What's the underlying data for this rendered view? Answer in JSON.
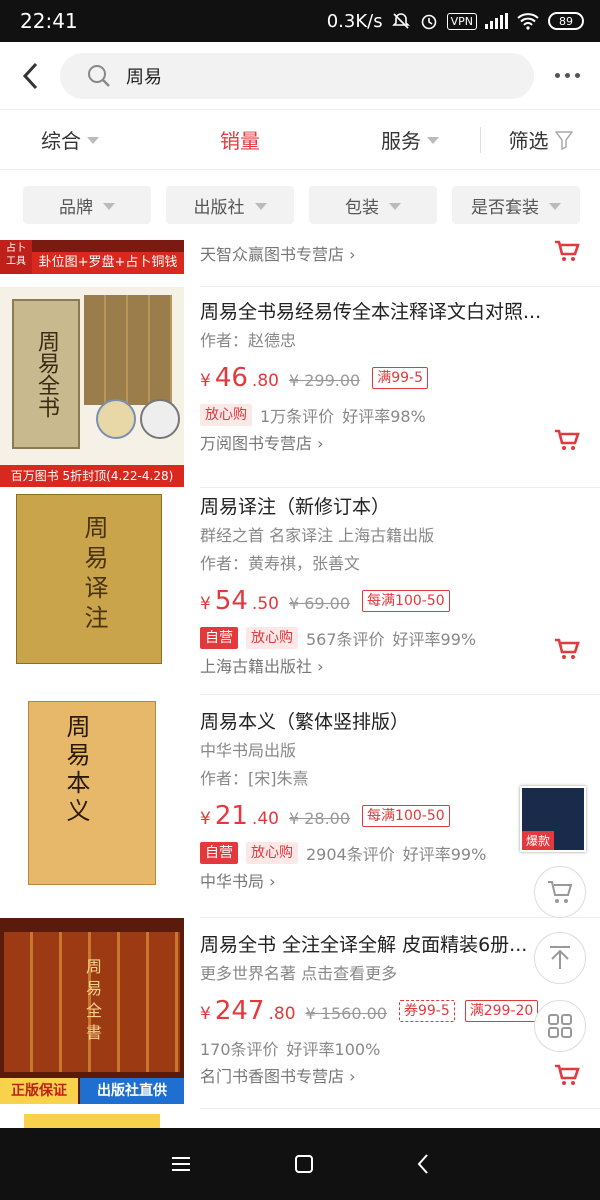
{
  "status": {
    "time": "22:41",
    "speed": "0.3K/s",
    "vpn": "VPN",
    "battery": "89"
  },
  "search": {
    "query": "周易"
  },
  "sort": {
    "items": [
      "综合",
      "销量",
      "服务",
      "筛选"
    ],
    "active_color": "#e4393c"
  },
  "filters": [
    "品牌",
    "出版社",
    "包装",
    "是否套装"
  ],
  "partial_item": {
    "banner": "卦位图+罗盘+占卜铜钱",
    "badge": "占卜\n工具",
    "shop": "天智众赢图书专营店"
  },
  "items": [
    {
      "title": "周易全书易经易传全本注释译文白对照...",
      "subtitle": "",
      "author": "作者：赵德忠",
      "price_int": "46",
      "price_dec": ".80",
      "orig": "¥ 299.00",
      "promo": "满99-5",
      "tags": [
        "放心购"
      ],
      "reviews": "1万条评价",
      "rate": "好评率98%",
      "shop": "万阅图书专营店",
      "banner": "百万图书 5折封顶(4.22-4.28)"
    },
    {
      "title": "周易译注（新修订本）",
      "subtitle": "群经之首 名家译注 上海古籍出版",
      "author": "作者：黄寿祺，张善文",
      "price_int": "54",
      "price_dec": ".50",
      "orig": "¥ 69.00",
      "promo": "每满100-50",
      "tags": [
        "自营",
        "放心购"
      ],
      "reviews": "567条评价",
      "rate": "好评率99%",
      "shop": "上海古籍出版社"
    },
    {
      "title": "周易本义（繁体竖排版）",
      "subtitle": "中华书局出版",
      "author": "作者：[宋]朱熹",
      "price_int": "21",
      "price_dec": ".40",
      "orig": "¥ 28.00",
      "promo": "每满100-50",
      "tags": [
        "自营",
        "放心购"
      ],
      "reviews": "2904条评价",
      "rate": "好评率99%",
      "shop": "中华书局"
    },
    {
      "title": "周易全书 全注全译全解 皮面精装6册...",
      "subtitle": "更多世界名著 点击查看更多",
      "author": "",
      "price_int": "247",
      "price_dec": ".80",
      "orig": "¥ 1560.00",
      "coupon": "券99-5",
      "promo": "满299-20",
      "tags": [],
      "reviews": "170条评价",
      "rate": "好评率100%",
      "shop": "名门书香图书专营店",
      "banner_left": "正版保证",
      "banner_right": "出版社直供"
    }
  ],
  "currency": "¥",
  "float_badge": "爆款",
  "book_texts": {
    "b1": "周易全书",
    "b2": "周易译注",
    "b3": "周易本义",
    "b4": "周易全書"
  }
}
